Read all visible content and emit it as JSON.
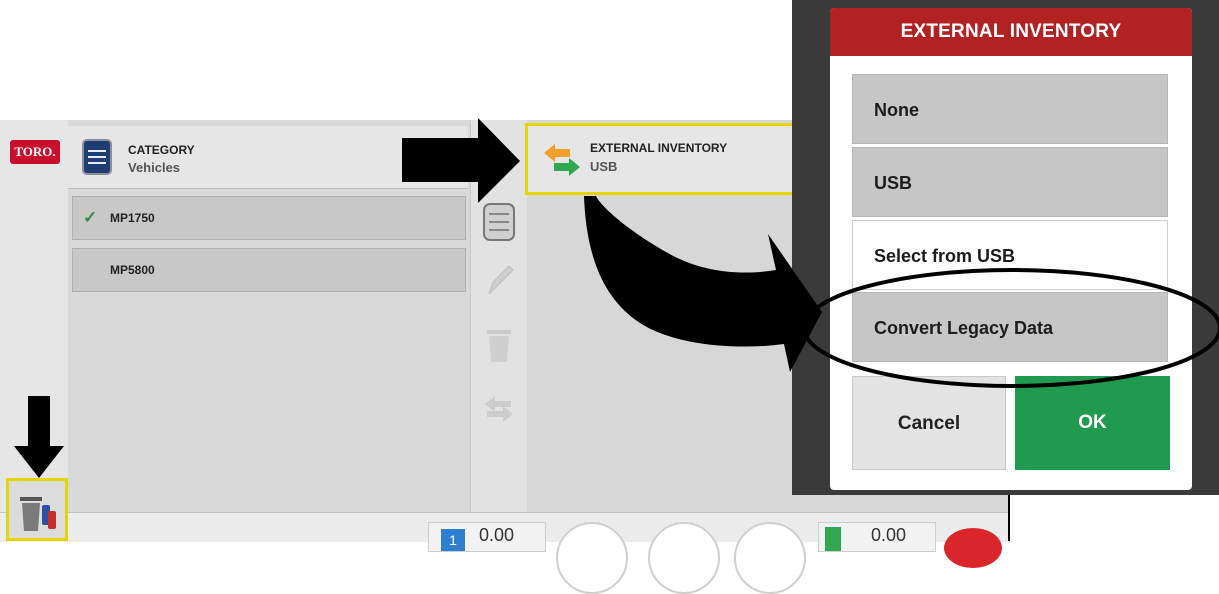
{
  "app": {
    "logo_text": "TORO.",
    "category": {
      "title": "CATEGORY",
      "value": "Vehicles"
    },
    "vehicles": [
      {
        "label": "MP1750",
        "selected": true
      },
      {
        "label": "MP5800",
        "selected": false
      }
    ],
    "external_inventory": {
      "title": "EXTERNAL INVENTORY",
      "value": "USB"
    },
    "status": {
      "readout_left": "0.00",
      "readout_right": "0.00",
      "badge": "1"
    }
  },
  "dialog": {
    "title": "EXTERNAL INVENTORY",
    "options": [
      "None",
      "USB",
      "Select from USB",
      "Convert Legacy Data"
    ],
    "cancel_label": "Cancel",
    "ok_label": "OK"
  },
  "colors": {
    "dialog_header": "#b22222",
    "ok_button": "#1f9a4f",
    "highlight": "#e6d600",
    "brand_red": "#c8102e"
  }
}
